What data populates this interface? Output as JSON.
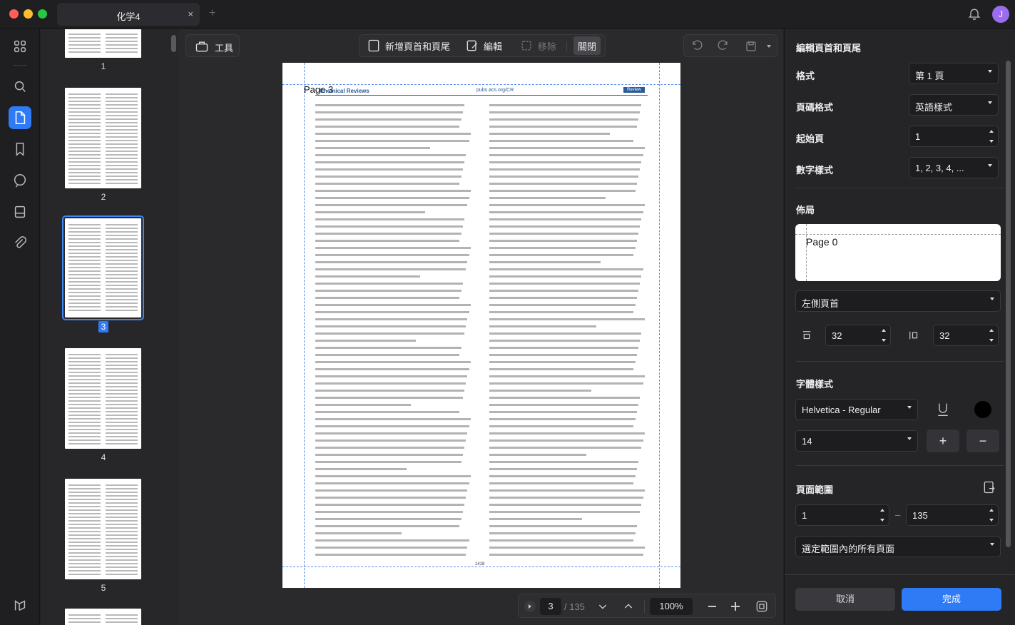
{
  "window": {
    "tab_title": "化学4",
    "close_glyph": "×",
    "new_tab_glyph": "+",
    "avatar_initial": "J"
  },
  "rail": {
    "icons": [
      "grid-icon",
      "search-icon",
      "page-icon",
      "bookmark-icon",
      "comment-icon",
      "stamp-icon",
      "attachment-icon"
    ],
    "active": "page-icon"
  },
  "thumbnails": [
    {
      "label": "1"
    },
    {
      "label": "2"
    },
    {
      "label": "3",
      "selected": true
    },
    {
      "label": "4"
    },
    {
      "label": "5"
    }
  ],
  "toolbar": {
    "tools_label": "工具",
    "add_header_footer_label": "新增頁首和頁尾",
    "edit_label": "編輯",
    "remove_label": "移除",
    "close_label": "關閉"
  },
  "document": {
    "page_header_text": "Page 3",
    "journal_left": "Chemical Reviews",
    "journal_center": "pubs.acs.org/CR",
    "journal_badge": "Review",
    "footer_center": "1418"
  },
  "pager": {
    "current_page": "3",
    "total_pages": "/ 135",
    "zoom": "100%"
  },
  "panel": {
    "title": "編輯頁首和頁尾",
    "format_label": "格式",
    "format_value": "第 1 頁",
    "page_num_format_label": "頁碼格式",
    "page_num_format_value": "英語樣式",
    "start_page_label": "起始頁",
    "start_page_value": "1",
    "number_style_label": "數字樣式",
    "number_style_value": "1, 2, 3, 4, ...",
    "layout_label": "佈局",
    "preview_text": "Page 0",
    "position_value": "左側頁首",
    "top_margin": "32",
    "side_margin": "32",
    "font_style_label": "字體樣式",
    "font_value": "Helvetica - Regular",
    "font_size": "14",
    "font_color": "#000000",
    "plus_glyph": "+",
    "minus_glyph": "−",
    "page_range_label": "頁面範圍",
    "range_start": "1",
    "range_dash": "–",
    "range_end": "135",
    "range_option": "選定範圍內的所有頁面",
    "cancel_label": "取消",
    "done_label": "完成"
  },
  "colors": {
    "accent": "#2f7bf6",
    "panel_bg": "#252528",
    "canvas_bg": "#2a2a2d"
  }
}
